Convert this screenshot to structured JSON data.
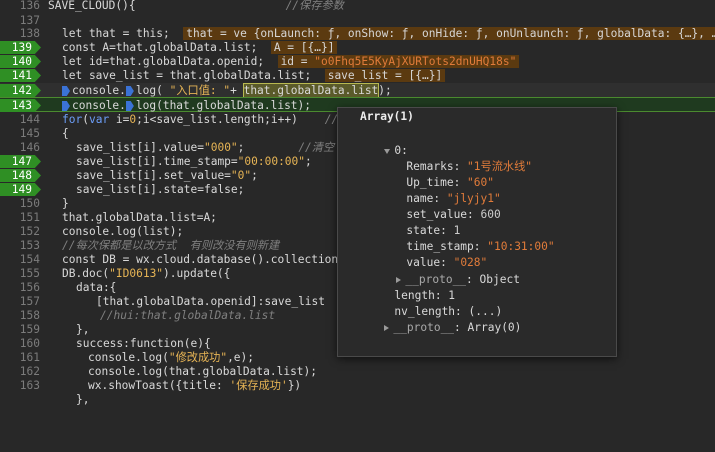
{
  "lines": [
    {
      "num": "136",
      "bp": false
    },
    {
      "num": "137",
      "bp": false
    },
    {
      "num": "138",
      "bp": false
    },
    {
      "num": "139",
      "bp": true
    },
    {
      "num": "140",
      "bp": true
    },
    {
      "num": "141",
      "bp": true
    },
    {
      "num": "142",
      "bp": true
    },
    {
      "num": "143",
      "bp": false
    },
    {
      "num": "144",
      "bp": false
    },
    {
      "num": "145",
      "bp": false
    },
    {
      "num": "146",
      "bp": false
    },
    {
      "num": "147",
      "bp": true
    },
    {
      "num": "148",
      "bp": true
    },
    {
      "num": "149",
      "bp": true
    },
    {
      "num": "150",
      "bp": false
    },
    {
      "num": "151",
      "bp": false
    },
    {
      "num": "152",
      "bp": false
    },
    {
      "num": "153",
      "bp": false
    },
    {
      "num": "154",
      "bp": false
    },
    {
      "num": "155",
      "bp": false
    },
    {
      "num": "156",
      "bp": false
    },
    {
      "num": "157",
      "bp": false
    },
    {
      "num": "158",
      "bp": false
    },
    {
      "num": "159",
      "bp": false
    },
    {
      "num": "160",
      "bp": false
    },
    {
      "num": "161",
      "bp": false
    },
    {
      "num": "162",
      "bp": false
    },
    {
      "num": "163",
      "bp": false
    }
  ],
  "code": {
    "l136": "SAVE_CLOUD(){",
    "l136_cmt": "//保存参数",
    "l138_a": "let that = this;",
    "l138_inl": "that = ve {onLaunch: ƒ, onShow: ƒ, onHide: ƒ, onUnlaunch: ƒ, globalData: {…}, …}",
    "l139_a": "const A=that.globalData.list;",
    "l139_inl": "A = [{…}]",
    "l140_a": "let id=that.globalData.openid;",
    "l140_inl_k": "id = ",
    "l140_inl_v": "\"o0Fhq5E5KyAjXURTots2dnUHQ18s\"",
    "l141_a": "let save_list = that.globalData.list;",
    "l141_inl": "save_list = [{…}]",
    "l142_a": "console.",
    "l142_b": "log( ",
    "l142_str": "\"入口值: \"",
    "l142_c": "+ ",
    "l142_sel": "that.globalData.list",
    "l142_d": ");",
    "l143_a": "console.",
    "l143_b": "log(that.globalData.list);",
    "l144": "for(var i=0;i<save_list.length;i++)",
    "l144_cmt": "//",
    "l145": "{",
    "l146_a": "save_list[i].value=",
    "l146_str": "\"000\"",
    "l146_b": ";",
    "l146_cmt": "//清空",
    "l147_a": "save_list[i].time_stamp=",
    "l147_str": "\"00:00:00\"",
    "l147_b": ";",
    "l148_a": "save_list[i].set_value=",
    "l148_str": "\"0\"",
    "l148_b": ";",
    "l149_a": "save_list[i].state=false;",
    "l150": "}",
    "l151": "that.globalData.list=A;",
    "l152": "console.log(list);",
    "l153_cmt": "//每次保都是以改方式  有则改没有则新建",
    "l154_a": "const DB = wx.cloud.database().collection(",
    "l155_a": "DB.doc(",
    "l155_str": "\"ID0613\"",
    "l155_b": ").update({",
    "l156": "data:{",
    "l157": "[that.globalData.openid]:save_list",
    "l158_cmt": "//hui:that.globalData.list",
    "l159": "},",
    "l160": "success:function(e){",
    "l161_a": "console.log(",
    "l161_str": "\"修改成功\"",
    "l161_b": ",e);",
    "l162": "console.log(that.globalData.list);",
    "l163_a": "wx.showToast({title: ",
    "l163_str": "'保存成功'",
    "l163_b": "})",
    "l164": "},"
  },
  "popup": {
    "title": "Array(1)",
    "index": "0:",
    "fields": [
      {
        "key": "Remarks: ",
        "val": "\"1号流水线\"",
        "type": "str"
      },
      {
        "key": "Up_time: ",
        "val": "\"60\"",
        "type": "str"
      },
      {
        "key": "name: ",
        "val": "\"jlyjy1\"",
        "type": "str"
      },
      {
        "key": "set_value: ",
        "val": "600",
        "type": "num"
      },
      {
        "key": "state: ",
        "val": "1",
        "type": "num"
      },
      {
        "key": "time_stamp: ",
        "val": "\"10:31:00\"",
        "type": "str"
      },
      {
        "key": "value: ",
        "val": "\"028\"",
        "type": "str"
      }
    ],
    "proto_obj_key": "__proto__",
    "proto_obj_val": ": Object",
    "length": "length: 1",
    "nv_length": "nv_length: (...)",
    "proto_arr_key": "__proto__",
    "proto_arr_val": ": Array(0)"
  },
  "colors": {
    "background": "#282828",
    "breakpoint": "#2f8f24",
    "string": "#e6b455",
    "keyword": "#6c9ef8",
    "comment": "#808080"
  }
}
